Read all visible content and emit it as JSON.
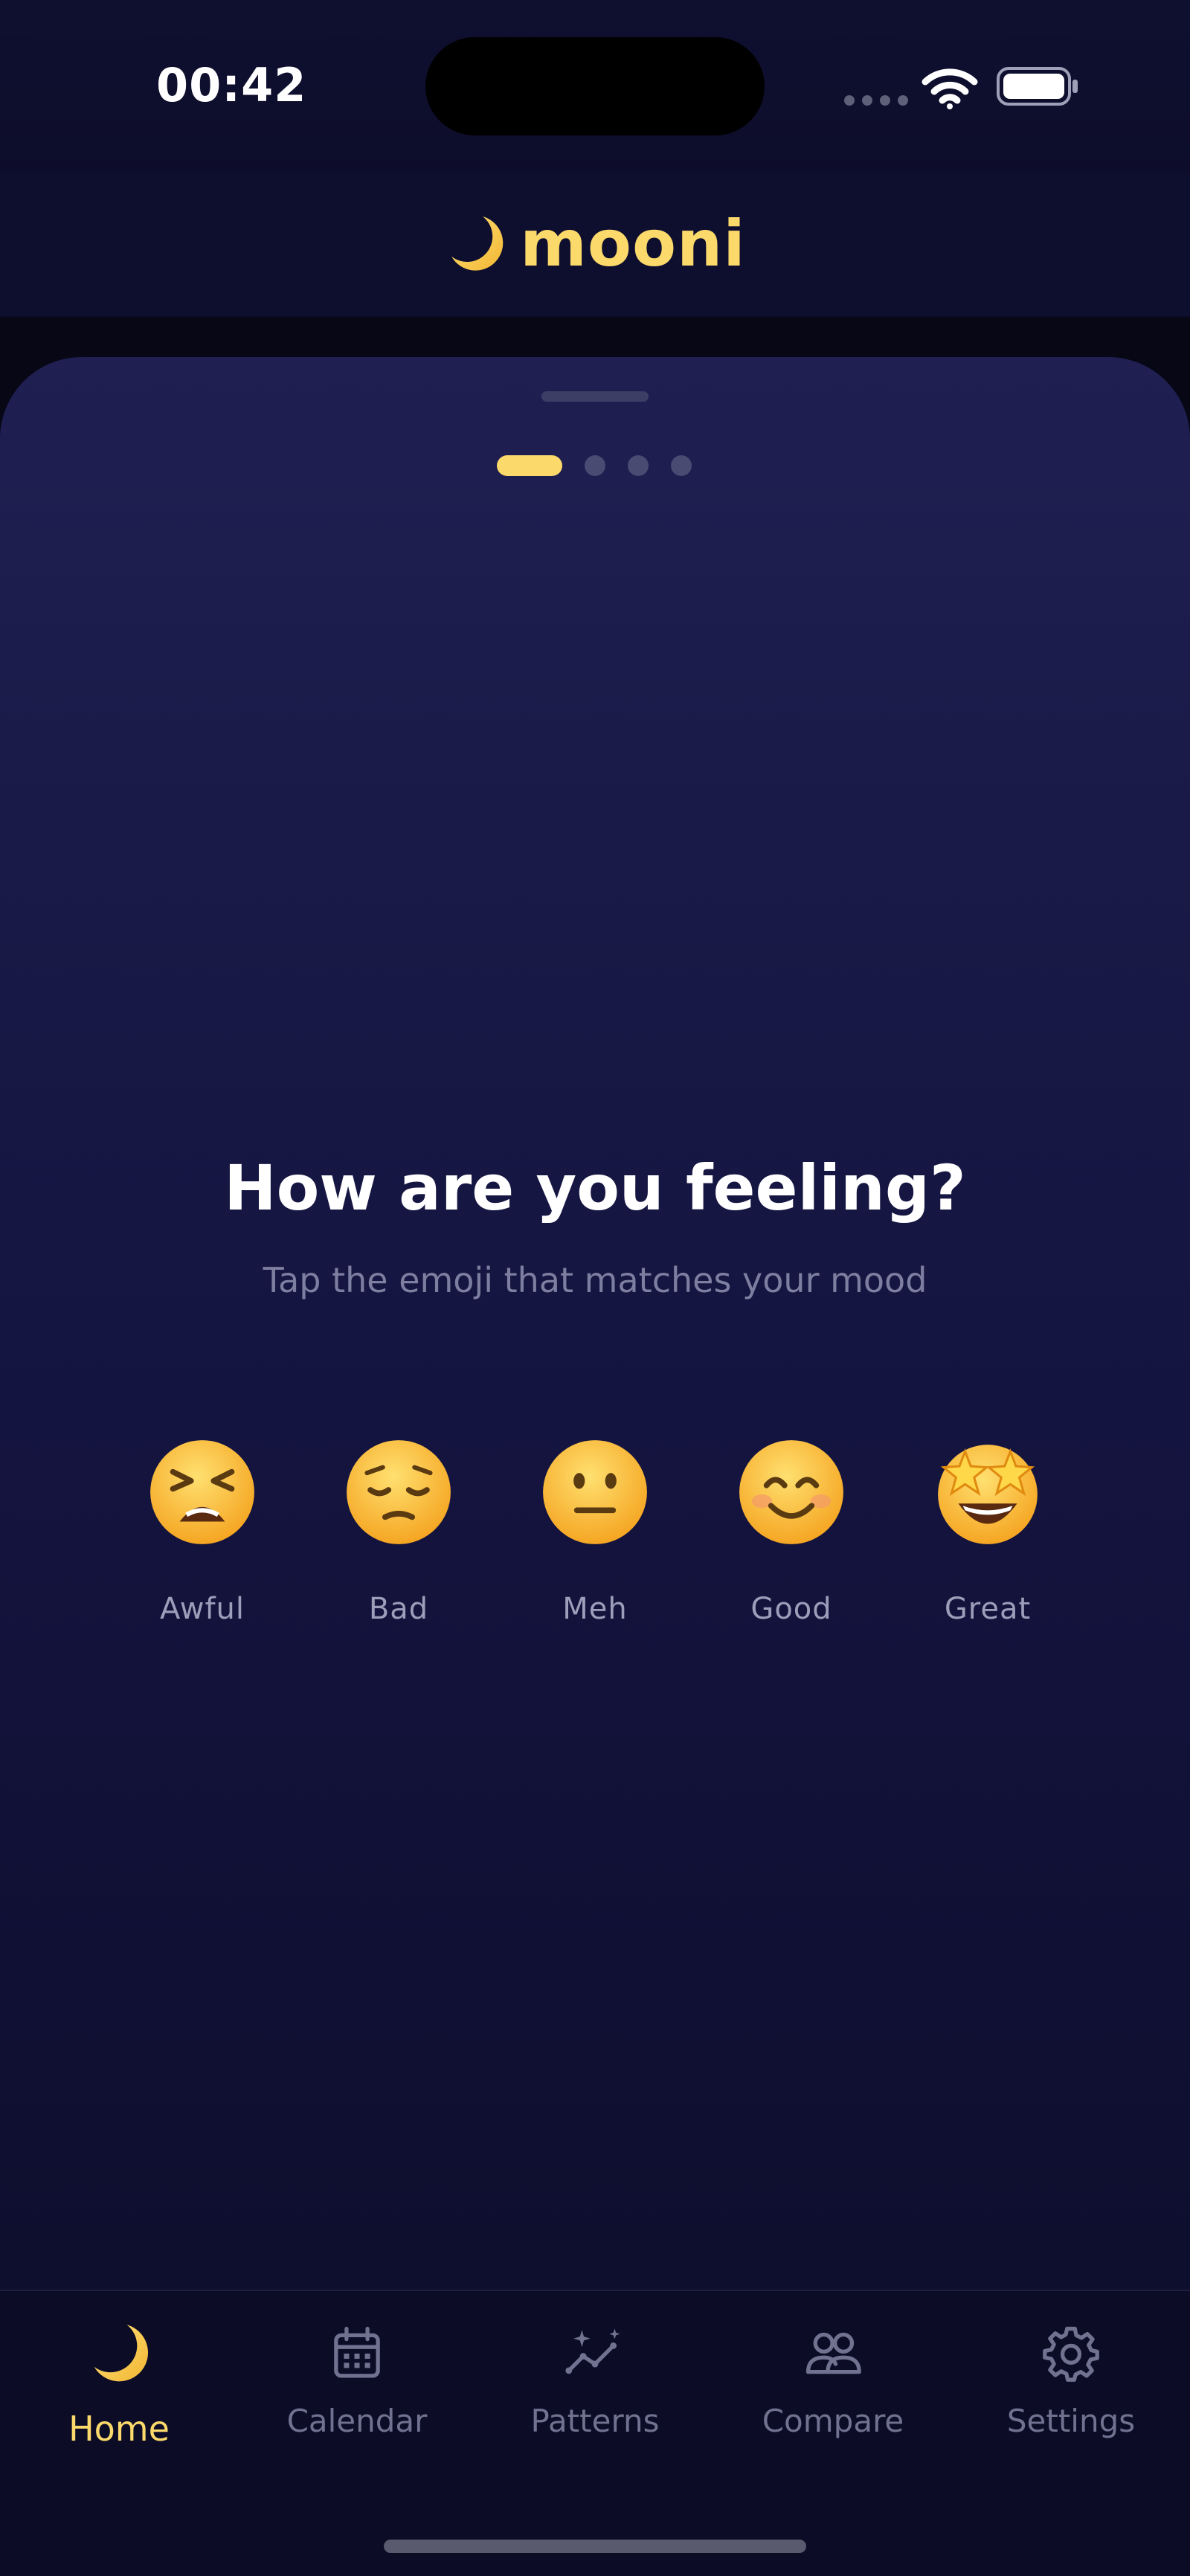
{
  "status_bar": {
    "time": "00:42",
    "wifi_icon": "wifi-icon",
    "battery_icon": "battery-full-icon"
  },
  "header": {
    "logo_icon": "crescent-moon-icon",
    "app_name": "mooni"
  },
  "colors": {
    "accent": "#fcd96b",
    "background": "#0c0c26",
    "sheet_top": "#1f1f52",
    "muted_text": "#7d7fa0",
    "tab_inactive": "#70728f"
  },
  "pager": {
    "total": 4,
    "current": 1
  },
  "mood_prompt": {
    "title": "How are you feeling?",
    "subtitle": "Tap the emoji that matches your mood",
    "options": [
      {
        "label": "Awful",
        "icon": "tired-face-emoji"
      },
      {
        "label": "Bad",
        "icon": "pensive-face-emoji"
      },
      {
        "label": "Meh",
        "icon": "neutral-face-emoji"
      },
      {
        "label": "Good",
        "icon": "smiling-face-emoji"
      },
      {
        "label": "Great",
        "icon": "star-struck-emoji"
      }
    ]
  },
  "tab_bar": {
    "tabs": [
      {
        "label": "Home",
        "icon": "crescent-moon-icon",
        "active": true
      },
      {
        "label": "Calendar",
        "icon": "calendar-icon",
        "active": false
      },
      {
        "label": "Patterns",
        "icon": "chart-sparkle-icon",
        "active": false
      },
      {
        "label": "Compare",
        "icon": "people-icon",
        "active": false
      },
      {
        "label": "Settings",
        "icon": "gear-icon",
        "active": false
      }
    ]
  }
}
